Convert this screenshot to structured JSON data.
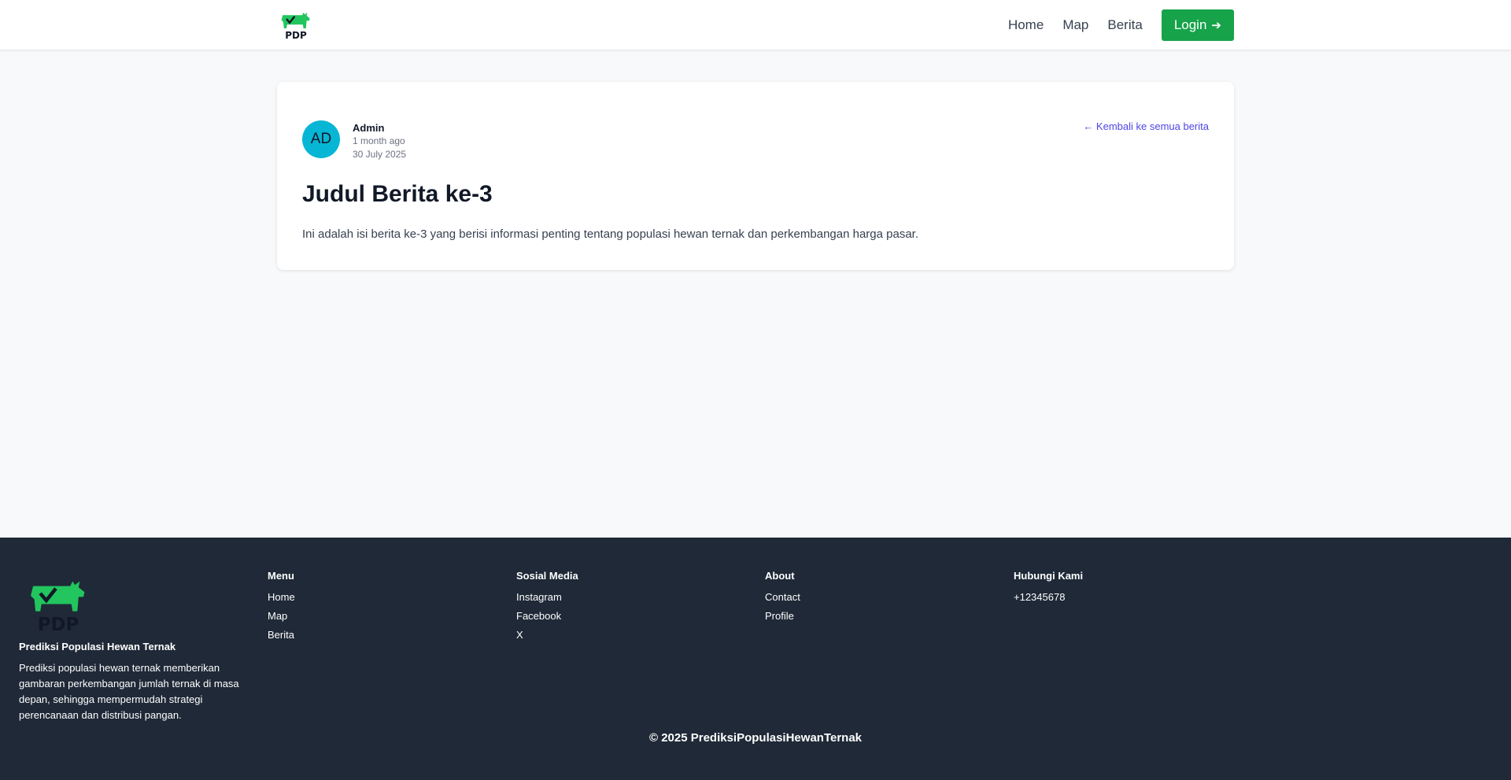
{
  "header": {
    "logo_text": "PDP",
    "nav": [
      {
        "label": "Home"
      },
      {
        "label": "Map"
      },
      {
        "label": "Berita"
      }
    ],
    "login_label": "Login",
    "login_icon": "arrow-right-icon"
  },
  "article": {
    "avatar_initials": "AD",
    "author": "Admin",
    "relative_time": "1 month ago",
    "date": "30 July 2025",
    "back_link": "← Kembali ke semua berita",
    "title": "Judul Berita ke-3",
    "body": "Ini adalah isi berita ke-3 yang berisi informasi penting tentang populasi hewan ternak dan perkembangan harga pasar."
  },
  "footer": {
    "logo_text": "PDP",
    "brand_title": "Prediksi Populasi Hewan Ternak",
    "brand_desc": "Prediksi populasi hewan ternak memberikan gambaran perkembangan jumlah ternak di masa depan, sehingga mempermudah strategi perencanaan dan distribusi pangan.",
    "columns": [
      {
        "title": "Menu",
        "items": [
          "Home",
          "Map",
          "Berita"
        ]
      },
      {
        "title": "Sosial Media",
        "items": [
          "Instagram",
          "Facebook",
          "X"
        ]
      },
      {
        "title": "About",
        "items": [
          "Contact",
          "Profile"
        ]
      },
      {
        "title": "Hubungi Kami",
        "items": [
          "+12345678"
        ]
      }
    ],
    "copyright": "© 2025 PrediksiPopulasiHewanTernak"
  },
  "colors": {
    "brand_green": "#16a34a",
    "logo_green": "#22c55e",
    "avatar_bg": "#06b6d4",
    "link": "#4f46e5",
    "footer_bg": "#1f2937"
  }
}
